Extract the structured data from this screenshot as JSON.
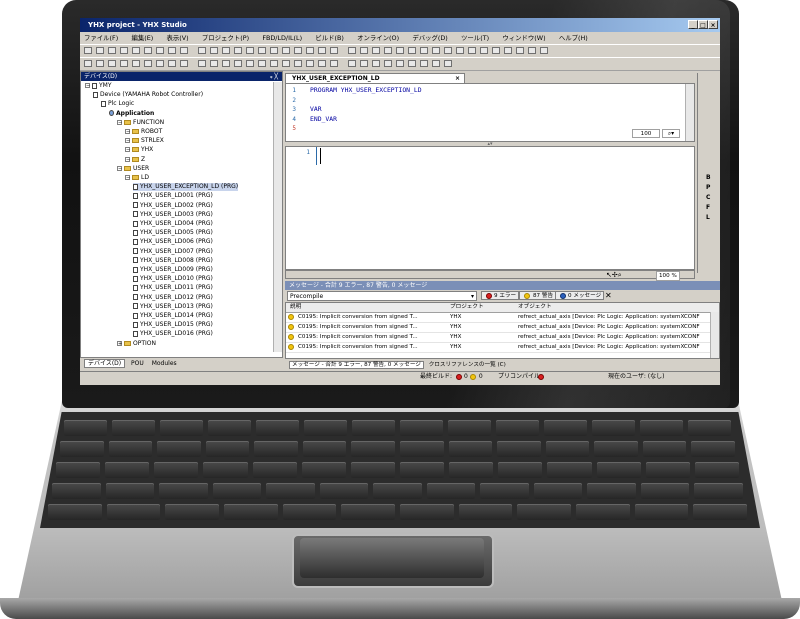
{
  "window": {
    "title": "YHX project - YHX Studio",
    "controls": [
      "_",
      "□",
      "×"
    ]
  },
  "menu": [
    "ファイル(F)",
    "編集(E)",
    "表示(V)",
    "プロジェクト(P)",
    "FBD/LD/IL(L)",
    "ビルド(B)",
    "オンライン(O)",
    "デバッグ(D)",
    "ツール(T)",
    "ウィンドウ(W)",
    "ヘルプ(H)"
  ],
  "devices_panel": {
    "title": "デバイス(D)",
    "pin": "ᵩ ╳",
    "tree": [
      {
        "label": "YMY",
        "indent": 0,
        "kind": "pm"
      },
      {
        "label": "Device (YAMAHA Robot Controller)",
        "indent": 1,
        "kind": "doc"
      },
      {
        "label": "Plc Logic",
        "indent": 2,
        "kind": "doc"
      },
      {
        "label": "Application",
        "indent": 3,
        "kind": "app"
      },
      {
        "label": "FUNCTION",
        "indent": 4,
        "kind": "folder"
      },
      {
        "label": "ROBOT",
        "indent": 5,
        "kind": "folder"
      },
      {
        "label": "STRLEX",
        "indent": 5,
        "kind": "folder"
      },
      {
        "label": "YHX",
        "indent": 5,
        "kind": "folder"
      },
      {
        "label": "Z",
        "indent": 5,
        "kind": "folder"
      },
      {
        "label": "USER",
        "indent": 4,
        "kind": "folder"
      },
      {
        "label": "LD",
        "indent": 5,
        "kind": "folder"
      },
      {
        "label": "YHX_USER_EXCEPTION_LD (PRG)",
        "indent": 6,
        "kind": "doc",
        "selected": true
      },
      {
        "label": "YHX_USER_LD001 (PRG)",
        "indent": 6,
        "kind": "doc"
      },
      {
        "label": "YHX_USER_LD002 (PRG)",
        "indent": 6,
        "kind": "doc"
      },
      {
        "label": "YHX_USER_LD003 (PRG)",
        "indent": 6,
        "kind": "doc"
      },
      {
        "label": "YHX_USER_LD004 (PRG)",
        "indent": 6,
        "kind": "doc"
      },
      {
        "label": "YHX_USER_LD005 (PRG)",
        "indent": 6,
        "kind": "doc"
      },
      {
        "label": "YHX_USER_LD006 (PRG)",
        "indent": 6,
        "kind": "doc"
      },
      {
        "label": "YHX_USER_LD007 (PRG)",
        "indent": 6,
        "kind": "doc"
      },
      {
        "label": "YHX_USER_LD008 (PRG)",
        "indent": 6,
        "kind": "doc"
      },
      {
        "label": "YHX_USER_LD009 (PRG)",
        "indent": 6,
        "kind": "doc"
      },
      {
        "label": "YHX_USER_LD010 (PRG)",
        "indent": 6,
        "kind": "doc"
      },
      {
        "label": "YHX_USER_LD011 (PRG)",
        "indent": 6,
        "kind": "doc"
      },
      {
        "label": "YHX_USER_LD012 (PRG)",
        "indent": 6,
        "kind": "doc"
      },
      {
        "label": "YHX_USER_LD013 (PRG)",
        "indent": 6,
        "kind": "doc"
      },
      {
        "label": "YHX_USER_LD014 (PRG)",
        "indent": 6,
        "kind": "doc"
      },
      {
        "label": "YHX_USER_LD015 (PRG)",
        "indent": 6,
        "kind": "doc"
      },
      {
        "label": "YHX_USER_LD016 (PRG)",
        "indent": 6,
        "kind": "doc"
      },
      {
        "label": "OPTION",
        "indent": 4,
        "kind": "folder"
      }
    ],
    "bottom_tabs": [
      "デバイス(D)",
      "POU",
      "Modules"
    ]
  },
  "editor": {
    "tab": "YHX_USER_EXCEPTION_LD",
    "decl_lines": [
      {
        "n": "1",
        "text": "PROGRAM YHX_USER_EXCEPTION_LD"
      },
      {
        "n": "2",
        "text": ""
      },
      {
        "n": "3",
        "text": "VAR"
      },
      {
        "n": "4",
        "text": "END_VAR"
      },
      {
        "n": "5",
        "text": ""
      }
    ],
    "impl_line": "1",
    "decl_zoom": "100",
    "impl_zoom": "100 %"
  },
  "side_markers": [
    "B",
    "P",
    "C",
    "F",
    "L"
  ],
  "messages": {
    "title": "メッセージ - 合計 9 エラー, 87 警告, 0 メッセージ",
    "filter": "Precompile",
    "errors_btn": "9 エラー",
    "warnings_btn": "87 警告",
    "messages_btn": "0 メッセージ",
    "columns": [
      "説明",
      "プロジェクト",
      "オブジェクト"
    ],
    "rows": [
      {
        "desc": "C0195: Implicit conversion from signed T...",
        "project": "YHX",
        "object": "refrect_actual_axis [Device: Plc Logic: Application: systemXCONF"
      },
      {
        "desc": "C0195: Implicit conversion from signed T...",
        "project": "YHX",
        "object": "refrect_actual_axis [Device: Plc Logic: Application: systemXCONF"
      },
      {
        "desc": "C0195: Implicit conversion from signed T...",
        "project": "YHX",
        "object": "refrect_actual_axis [Device: Plc Logic: Application: systemXCONF"
      },
      {
        "desc": "C0195: Implicit conversion from signed T...",
        "project": "YHX",
        "object": "refrect_actual_axis [Device: Plc Logic: Application: systemXCONF"
      }
    ],
    "bottom_tabs": [
      "メッセージ - 合計 9 エラー, 87 警告, 0 メッセージ",
      "クロスリファレンスの一覧 (C)"
    ]
  },
  "status": {
    "last_build": "最終ビルド:",
    "err_count": "0",
    "warn_count": "0",
    "precompile": "プリコンパイル",
    "user": "現在のユーザ: (なし)"
  }
}
